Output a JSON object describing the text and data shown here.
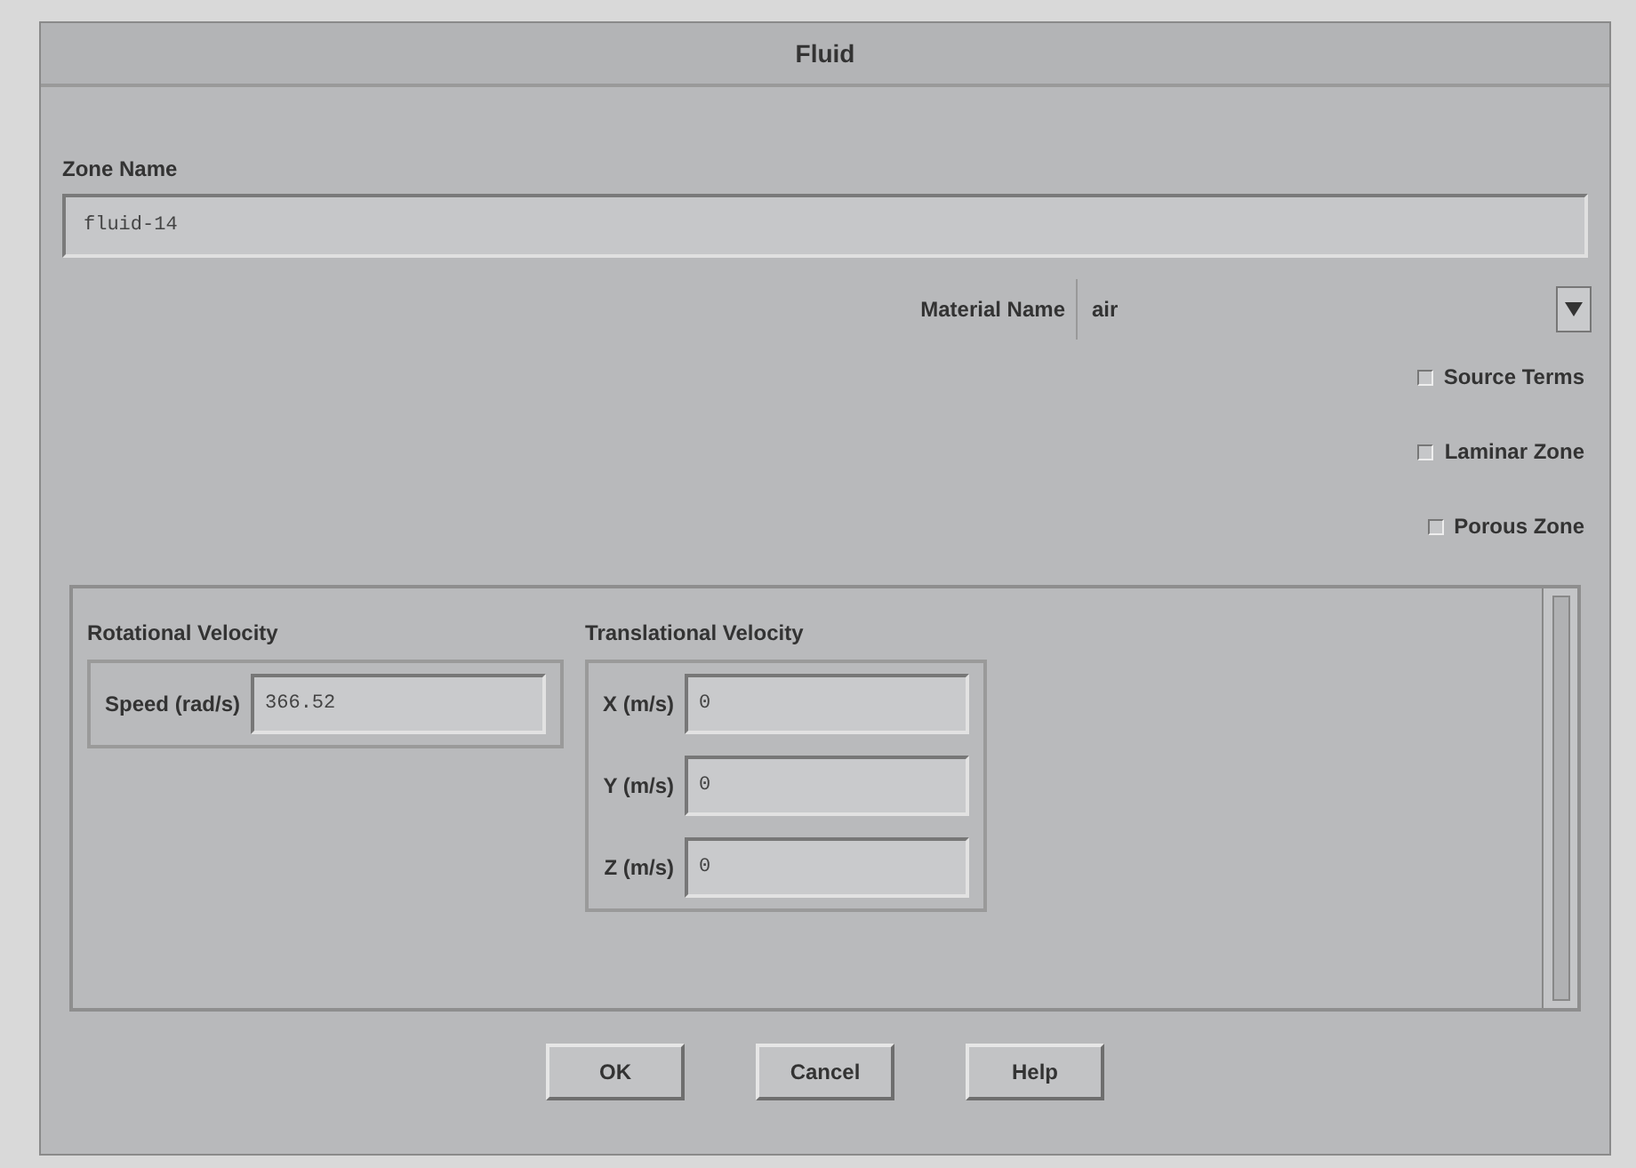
{
  "window": {
    "title": "Fluid"
  },
  "zone_name": {
    "label": "Zone Name",
    "value": "fluid-14"
  },
  "material": {
    "label": "Material Name",
    "value": "air"
  },
  "options": [
    {
      "label": "Source Terms",
      "checked": false
    },
    {
      "label": "Laminar Zone",
      "checked": false
    },
    {
      "label": "Porous Zone",
      "checked": false
    }
  ],
  "rotational_velocity": {
    "title": "Rotational Velocity",
    "fields": [
      {
        "label": "Speed (rad/s)",
        "value": "366.52"
      }
    ]
  },
  "translational_velocity": {
    "title": "Translational Velocity",
    "fields": [
      {
        "label": "X (m/s)",
        "value": "0"
      },
      {
        "label": "Y (m/s)",
        "value": "0"
      },
      {
        "label": "Z (m/s)",
        "value": "0"
      }
    ]
  },
  "buttons": [
    "OK",
    "Cancel",
    "Help"
  ]
}
